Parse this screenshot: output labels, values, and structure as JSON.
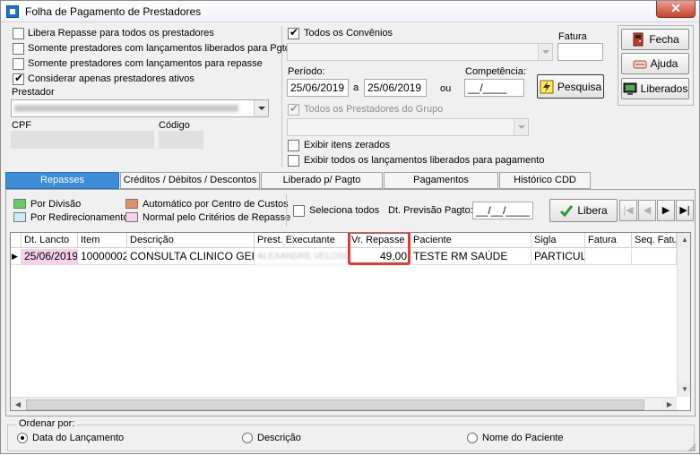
{
  "window": {
    "title": "Folha de Pagamento de Prestadores",
    "close": "✕"
  },
  "left_options": [
    {
      "label": "Libera Repasse para todos os prestadores",
      "checked": false
    },
    {
      "label": "Somente prestadores com lançamentos liberados para Pgto.",
      "checked": false
    },
    {
      "label": "Somente prestadores com lançamentos para repasse",
      "checked": false
    },
    {
      "label": "Considerar apenas prestadores ativos",
      "checked": true
    }
  ],
  "prestador": {
    "label": "Prestador",
    "value": "ALEXANDRE VELOSO PIMENTA DE FIGUEIREDO"
  },
  "cpf": {
    "label": "CPF",
    "value": ""
  },
  "codigo": {
    "label": "Código",
    "value": ""
  },
  "convenios": {
    "label": "Todos os Convênios",
    "checked": true
  },
  "fatura": {
    "label": "Fatura",
    "value": ""
  },
  "periodo": {
    "label": "Período:",
    "from": "25/06/2019",
    "sep": "a",
    "to": "25/06/2019",
    "ou": "ou"
  },
  "competencia": {
    "label": "Competência:",
    "value": "__/____"
  },
  "pesquisa_button": "Pesquisa",
  "prestadores_grupo": {
    "label": "Todos os Prestadores do Grupo",
    "checked": true
  },
  "exibir_options": [
    {
      "label": "Exibir itens zerados",
      "checked": false
    },
    {
      "label": "Exibir todos os lançamentos liberados para pagamento",
      "checked": false
    }
  ],
  "side_buttons": {
    "fecha": "Fecha",
    "ajuda": "Ajuda",
    "liberados": "Liberados"
  },
  "tabs": [
    "Repasses",
    "Créditos / Débitos / Descontos",
    "Liberado p/ Pagto",
    "Pagamentos",
    "Histórico CDD"
  ],
  "legend": [
    {
      "label": "Por Divisão",
      "color": "#66cc66"
    },
    {
      "label": "Por Redirecionamento",
      "color": "#c8ecf8"
    },
    {
      "label": "Automático por Centro de Custos",
      "color": "#e0906a"
    },
    {
      "label": "Normal pelo Critérios de Repasse",
      "color": "#f8d0ec"
    }
  ],
  "seleciona_todos": {
    "label": "Seleciona todos",
    "checked": false
  },
  "previsao": {
    "label": "Dt. Previsão Pagto:",
    "value": "__/__/____"
  },
  "libera_button": "Libera",
  "nav": {
    "first": "|◀",
    "prev": "◀",
    "next": "▶",
    "last": "▶|"
  },
  "grid": {
    "columns": [
      "Dt. Lancto",
      "Item",
      "Descrição",
      "Prest. Executante",
      "Vr. Repasse",
      "Paciente",
      "Sigla",
      "Fatura",
      "Seq. Fatura"
    ],
    "rows": [
      {
        "marker": "▶",
        "dt": "25/06/2019",
        "item": "10000002",
        "descricao": "CONSULTA CLINICO GERAL",
        "prestador": "ALEXANDRE VELOSO PIMENTA DE FIGUEIREDO",
        "valor": "49,00",
        "paciente": "TESTE RM SAÚDE",
        "sigla": "PARTICULAR",
        "fatura": "",
        "seq": ""
      }
    ]
  },
  "ordenar": {
    "label": "Ordenar por:",
    "options": [
      {
        "label": "Data do Lançamento",
        "checked": true
      },
      {
        "label": "Descrição",
        "checked": false
      },
      {
        "label": "Nome do Paciente",
        "checked": false
      }
    ]
  },
  "colors": {
    "accent_tab": "#3c8cd8",
    "highlight_border": "#e03c31",
    "row_date_bg": "#f8d0ec"
  }
}
